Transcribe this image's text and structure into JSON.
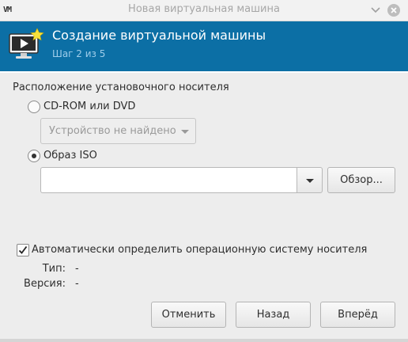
{
  "window": {
    "logo_text": "VM",
    "title": "Новая виртуальная машина"
  },
  "banner": {
    "title": "Создание виртуальной машины",
    "subtitle": "Шаг 2 из 5",
    "icon": "monitor-play-star-icon",
    "background_color": "#0c6fa5"
  },
  "install_media": {
    "section_title": "Расположение установочного носителя",
    "cdrom": {
      "label": "CD-ROM или DVD",
      "selected": false,
      "device_combo_value": "Устройство не найдено",
      "device_combo_enabled": false
    },
    "iso": {
      "label": "Образ ISO",
      "selected": true,
      "path_value": "",
      "browse_label": "Обзор..."
    }
  },
  "os_detection": {
    "auto_detect_label": "Автоматически определить операционную систему носителя",
    "auto_detect_checked": true,
    "type_label": "Тип:",
    "type_value": "-",
    "version_label": "Версия:",
    "version_value": "-"
  },
  "footer": {
    "cancel_label": "Отменить",
    "back_label": "Назад",
    "forward_label": "Вперёд"
  }
}
